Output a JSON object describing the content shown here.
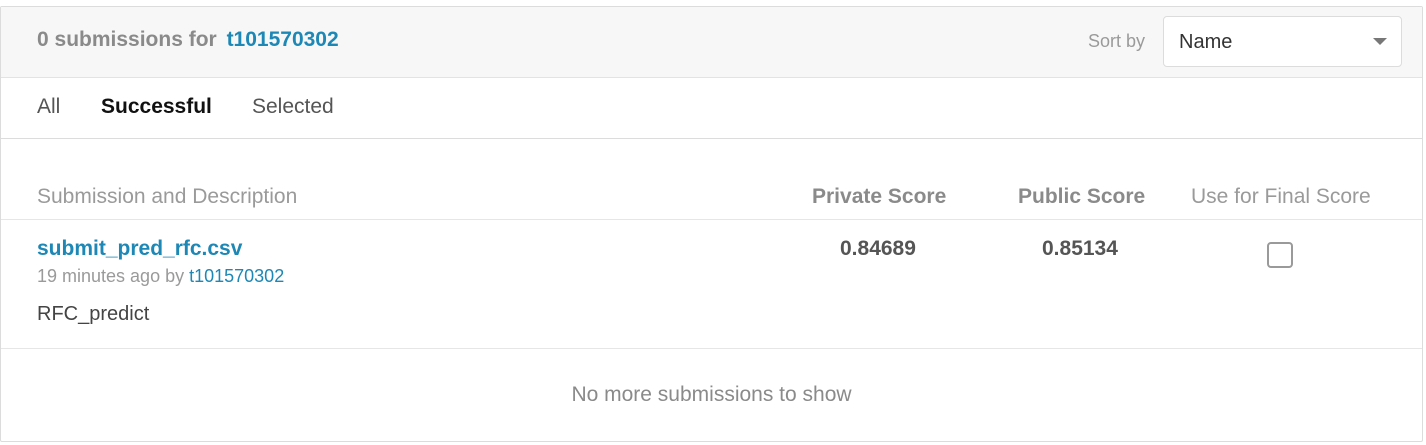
{
  "header": {
    "count_text": "0 submissions for",
    "username": "t101570302",
    "sort_label": "Sort by",
    "sort_value": "Name"
  },
  "tabs": [
    {
      "label": "All",
      "active": false
    },
    {
      "label": "Successful",
      "active": true
    },
    {
      "label": "Selected",
      "active": false
    }
  ],
  "table": {
    "columns": {
      "submission": "Submission and Description",
      "private": "Private Score",
      "public": "Public Score",
      "final": "Use for Final Score"
    },
    "rows": [
      {
        "file": "submit_pred_rfc.csv",
        "time": "19 minutes ago by",
        "user": "t101570302",
        "description": "RFC_predict",
        "private_score": "0.84689",
        "public_score": "0.85134",
        "use_for_final": false
      }
    ]
  },
  "footer": {
    "message": "No more submissions to show"
  },
  "colors": {
    "link": "#1d87b5",
    "header_bg": "#f7f7f7",
    "muted_text": "#8a8a8a"
  }
}
